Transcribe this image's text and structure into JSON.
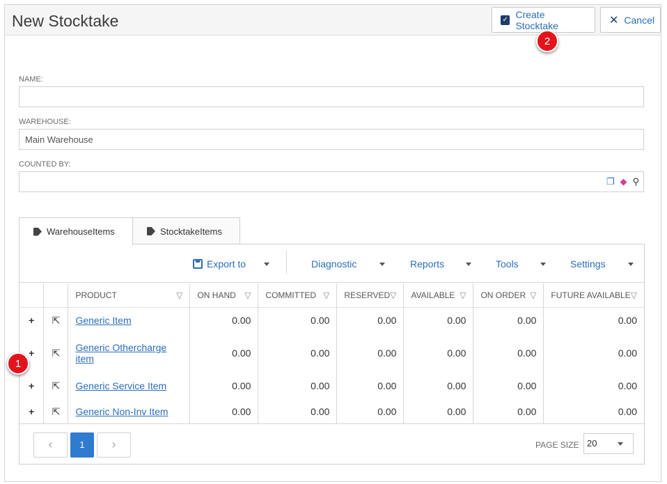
{
  "header": {
    "title": "New Stocktake",
    "create_label": "Create Stocktake",
    "cancel_label": "Cancel"
  },
  "callouts": {
    "one": "1",
    "two": "2"
  },
  "form": {
    "name_label": "NAME:",
    "name_value": "",
    "warehouse_label": "WAREHOUSE:",
    "warehouse_value": "Main Warehouse",
    "counted_by_label": "COUNTED BY:",
    "counted_by_value": ""
  },
  "tabs": [
    {
      "label": "WarehouseItems",
      "active": true
    },
    {
      "label": "StocktakeItems",
      "active": false
    }
  ],
  "toolbar": {
    "export": "Export to",
    "diagnostic": "Diagnostic",
    "reports": "Reports",
    "tools": "Tools",
    "settings": "Settings"
  },
  "columns": [
    "PRODUCT",
    "ON HAND",
    "COMMITTED",
    "RESERVED",
    "AVAILABLE",
    "ON ORDER",
    "FUTURE AVAILABLE"
  ],
  "rows": [
    {
      "product": "Generic Item",
      "on_hand": "0.00",
      "committed": "0.00",
      "reserved": "0.00",
      "available": "0.00",
      "on_order": "0.00",
      "future_available": "0.00"
    },
    {
      "product": "Generic Othercharge item",
      "on_hand": "0.00",
      "committed": "0.00",
      "reserved": "0.00",
      "available": "0.00",
      "on_order": "0.00",
      "future_available": "0.00"
    },
    {
      "product": "Generic Service Item",
      "on_hand": "0.00",
      "committed": "0.00",
      "reserved": "0.00",
      "available": "0.00",
      "on_order": "0.00",
      "future_available": "0.00"
    },
    {
      "product": "Generic Non-Inv Item",
      "on_hand": "0.00",
      "committed": "0.00",
      "reserved": "0.00",
      "available": "0.00",
      "on_order": "0.00",
      "future_available": "0.00"
    }
  ],
  "pager": {
    "prev": "‹",
    "current": "1",
    "next": "›",
    "page_size_label": "PAGE SIZE",
    "page_size_value": "20"
  }
}
